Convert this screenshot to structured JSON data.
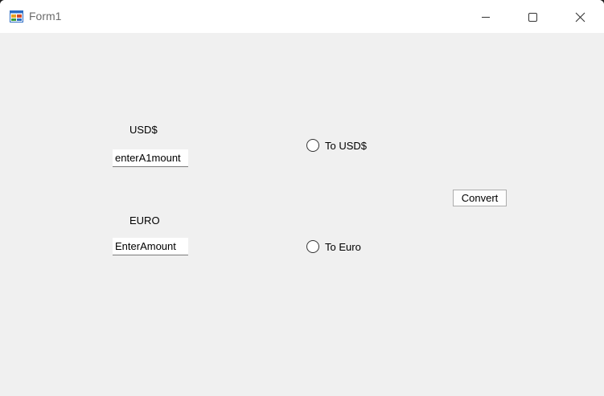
{
  "window": {
    "title": "Form1"
  },
  "titlebar_buttons": {
    "minimize_icon": "minimize-icon",
    "maximize_icon": "maximize-icon",
    "close_icon": "close-icon"
  },
  "form": {
    "usd_label": "USD$",
    "usd_input_value": "enterA1mount",
    "euro_label": "EURO",
    "euro_input_value": "EnterAmount",
    "radio_to_usd_label": "To USD$",
    "radio_to_usd_checked": false,
    "radio_to_euro_label": "To Euro",
    "radio_to_euro_checked": false,
    "convert_button_label": "Convert"
  },
  "colors": {
    "titlebar_bg": "#ffffff",
    "client_bg": "#f0f0f0",
    "title_text": "#6b6b6b"
  }
}
